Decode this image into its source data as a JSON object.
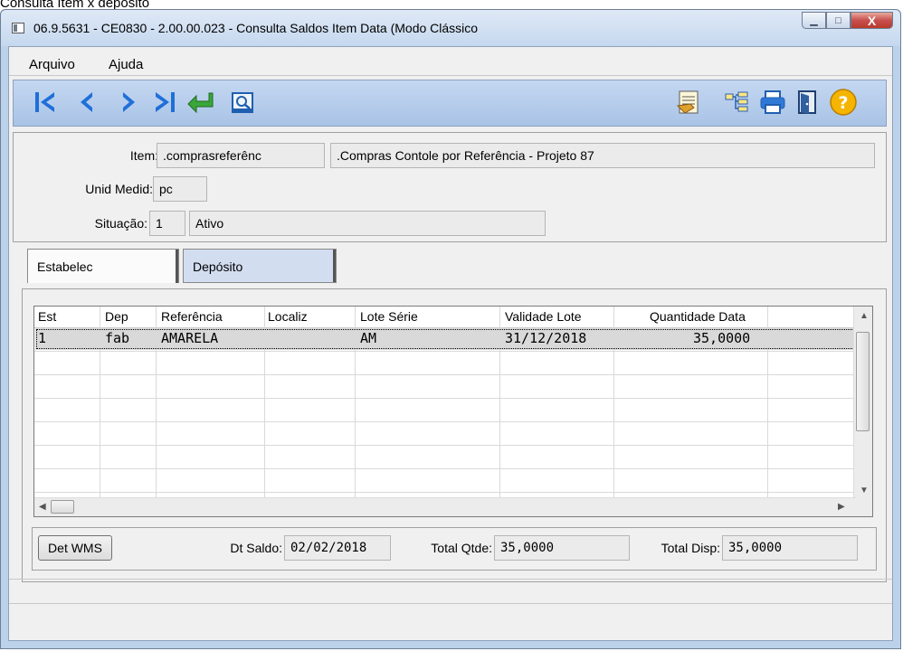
{
  "caption": "Consulta Item x depósito",
  "window": {
    "title": "06.9.5631 - CE0830 - 2.00.00.023 - Consulta Saldos Item Data (Modo Clássico",
    "minimize": "▁",
    "maximize": "□",
    "close": "X"
  },
  "menu": {
    "file": "Arquivo",
    "help": "Ajuda"
  },
  "toolbar": {
    "icons": [
      "first-record-icon",
      "previous-record-icon",
      "next-record-icon",
      "last-record-icon",
      "goto-icon",
      "search-icon",
      "report-icon",
      "hierarchy-icon",
      "print-icon",
      "exit-icon",
      "help-icon"
    ],
    "help_glyph": "?"
  },
  "form": {
    "item_label": "Item:",
    "item_code": ".comprasreferênc",
    "item_desc": ".Compras Contole por Referência - Projeto 87",
    "unit_label": "Unid Medid:",
    "unit_value": "pc",
    "status_label": "Situação:",
    "status_code": "1",
    "status_desc": "Ativo"
  },
  "tabs": [
    "Estabelec",
    "Depósito"
  ],
  "grid": {
    "headers": [
      "Est",
      "Dep",
      "Referência",
      "Localiz",
      "Lote Série",
      "Validade Lote",
      "Quantidade Data"
    ],
    "rows": [
      [
        "1",
        "fab",
        "AMARELA",
        "",
        "AM",
        "31/12/2018",
        "35,0000"
      ]
    ]
  },
  "footer": {
    "wms_button": "Det WMS",
    "dt_saldo_label": "Dt Saldo:",
    "dt_saldo_value": "02/02/2018",
    "total_qtde_label": "Total Qtde:",
    "total_qtde_value": "35,0000",
    "total_disp_label": "Total Disp:",
    "total_disp_value": "35,0000"
  },
  "colors": {
    "toolbar_blue": "#1f6fd9",
    "help_orange": "#f0a800"
  }
}
